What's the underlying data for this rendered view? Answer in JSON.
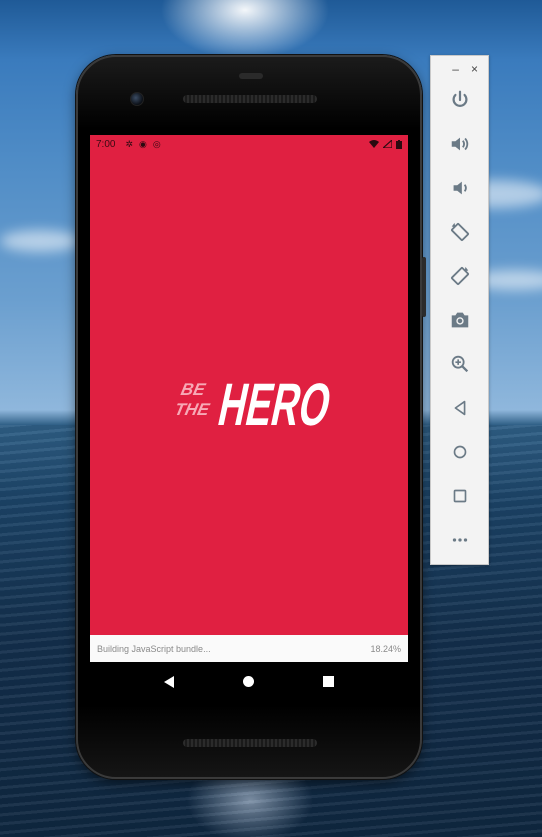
{
  "emulator_toolbar": {
    "minimize_label": "–",
    "close_label": "×",
    "buttons": [
      {
        "name": "power-icon"
      },
      {
        "name": "volume-up-icon"
      },
      {
        "name": "volume-down-icon"
      },
      {
        "name": "rotate-left-icon"
      },
      {
        "name": "rotate-right-icon"
      },
      {
        "name": "camera-icon"
      },
      {
        "name": "zoom-icon"
      },
      {
        "name": "back-icon"
      },
      {
        "name": "home-icon"
      },
      {
        "name": "overview-icon"
      },
      {
        "name": "more-icon"
      }
    ]
  },
  "device": {
    "status_bar": {
      "time": "7:00",
      "icons_left": [
        "settings-icon",
        "app-icon",
        "sync-icon"
      ],
      "icons_right": [
        "wifi-icon",
        "signal-icon",
        "battery-icon"
      ]
    },
    "splash": {
      "background_color": "#E02041",
      "logo": {
        "line1": "BE",
        "line2": "THE",
        "main": "HERO"
      }
    },
    "bundle_bar": {
      "status_text": "Building JavaScript bundle...",
      "progress_text": "18.24%"
    },
    "nav_bar": {
      "buttons": [
        "back",
        "home",
        "recents"
      ]
    }
  }
}
